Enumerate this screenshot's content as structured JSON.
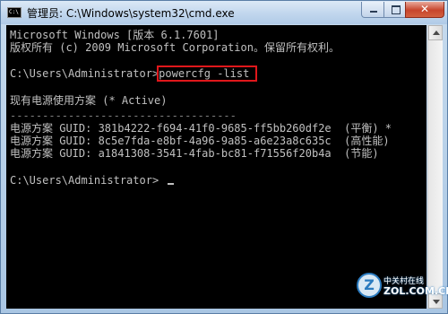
{
  "window": {
    "title": "管理员: C:\\Windows\\system32\\cmd.exe",
    "app_icon_text": "C:\\",
    "close_glyph": "✕"
  },
  "console": {
    "lines": [
      "Microsoft Windows [版本 6.1.7601]",
      "版权所有 (c) 2009 Microsoft Corporation。保留所有权利。",
      "",
      "C:\\Users\\Administrator>powercfg -list",
      "",
      "现有电源使用方案 (* Active)",
      "-----------------------------------",
      "电源方案 GUID: 381b4222-f694-41f0-9685-ff5bb260df2e  (平衡) *",
      "电源方案 GUID: 8c5e7fda-e8bf-4a96-9a85-a6e23a8c635c  (高性能)",
      "电源方案 GUID: a1841308-3541-4fab-bc81-f71556f20b4a  (节能)",
      "",
      "C:\\Users\\Administrator>"
    ],
    "highlighted_command": "powercfg -list"
  },
  "watermark": {
    "logo_letter": "Z",
    "brand": "中关村在线",
    "site": "ZOL.COM.CN"
  },
  "colors": {
    "console_background": "#000000",
    "console_text": "#c0c0c0",
    "highlight_border": "#e0171b"
  },
  "icons": [
    "cmd-app-icon",
    "minimize-icon",
    "maximize-icon",
    "close-icon",
    "scroll-up-arrow-icon",
    "scroll-down-arrow-icon"
  ]
}
